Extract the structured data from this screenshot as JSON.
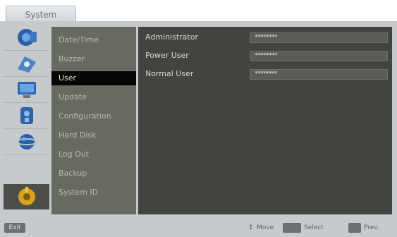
{
  "tab": {
    "label": "System"
  },
  "icons": [
    "camera-icon",
    "disk-icon",
    "monitor-icon",
    "lock-icon",
    "globe-icon",
    "tools-icon"
  ],
  "menu": {
    "items": [
      "Date/Time",
      "Buzzer",
      "User",
      "Update",
      "Configuration",
      "Hard Disk",
      "Log Out",
      "Backup",
      "System ID"
    ],
    "selected": "User"
  },
  "users": [
    {
      "label": "Administrator",
      "password": "********"
    },
    {
      "label": "Power User",
      "password": "********"
    },
    {
      "label": "Normal User",
      "password": "********"
    }
  ],
  "status": {
    "exit_label": "Exit",
    "move_label": "Move",
    "move_glyph": "↕",
    "select_label": "Select",
    "prev_label": "Prev."
  },
  "colors": {
    "selected_bg": "#050505",
    "panel_bg": "#43443f",
    "menu_bg": "#676a61"
  }
}
